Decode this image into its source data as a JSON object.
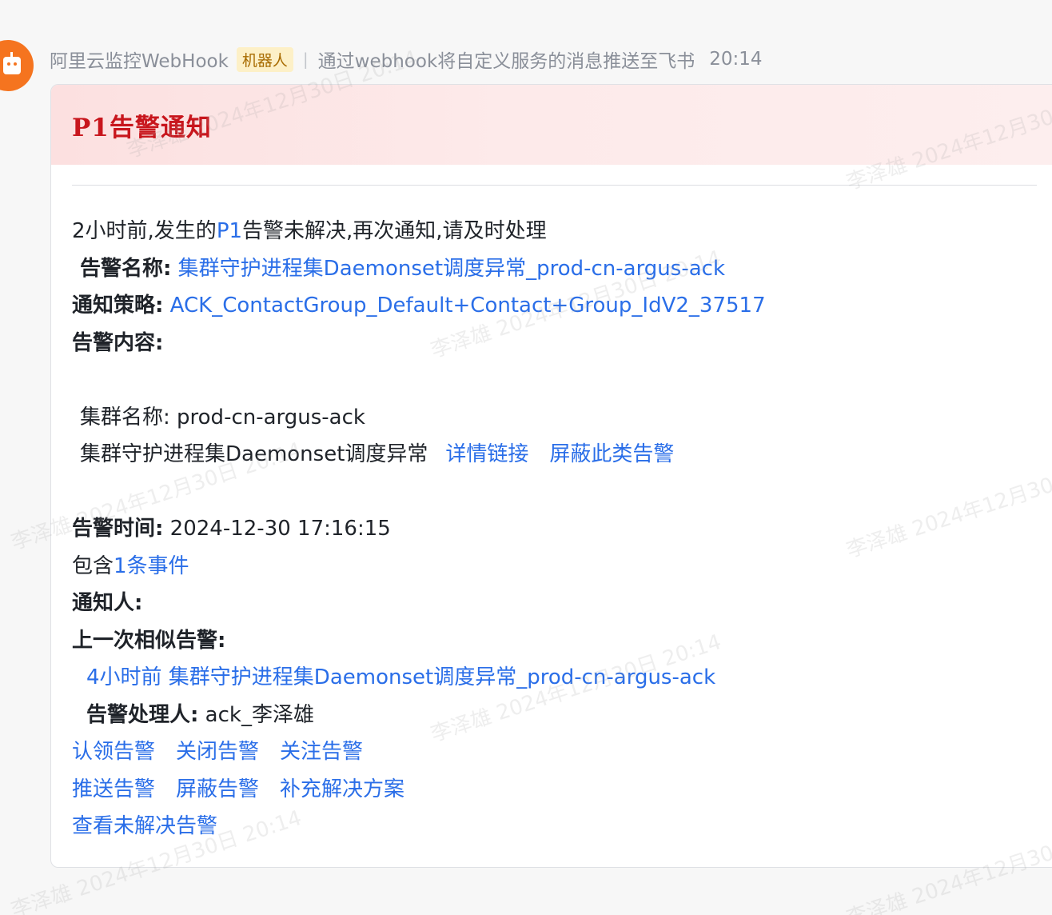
{
  "sender": {
    "name": "阿里云监控WebHook",
    "tag": "机器人",
    "separator": "|",
    "description": "通过webhook将自定义服务的消息推送至飞书",
    "time": "20:14"
  },
  "card": {
    "title": "P1告警通知",
    "intro": {
      "prefix": "2小时前,发生的",
      "level": "P1",
      "suffix": "告警未解决,再次通知,请及时处理"
    },
    "alert_name_label": "告警名称:",
    "alert_name": "集群守护进程集Daemonset调度异常_prod-cn-argus-ack",
    "policy_label": "通知策略:",
    "policy": "ACK_ContactGroup_Default+Contact+Group_IdV2_37517",
    "content_label": "告警内容:",
    "cluster_label": "集群名称:",
    "cluster_name": "prod-cn-argus-ack",
    "anomaly_text": "集群守护进程集Daemonset调度异常",
    "detail_link": "详情链接",
    "mute_similar_link": "屏蔽此类告警",
    "alert_time_label": "告警时间:",
    "alert_time": "2024-12-30 17:16:15",
    "contains_prefix": "包含",
    "contains_link": "1条事件",
    "notifier_label": "通知人:",
    "last_similar_label": "上一次相似告警:",
    "last_similar_link": "4小时前 集群守护进程集Daemonset调度异常_prod-cn-argus-ack",
    "handler_label": "告警处理人:",
    "handler": "ack_李泽雄",
    "actions_row1": [
      "认领告警",
      "关闭告警",
      "关注告警"
    ],
    "actions_row2": [
      "推送告警",
      "屏蔽告警",
      "补充解决方案"
    ],
    "actions_row3": [
      "查看未解决告警"
    ]
  },
  "watermark": "李泽雄 2024年12月30日 20:14",
  "colors": {
    "title_red": "#c8161d",
    "link_blue": "#2a6ee8",
    "avatar_orange": "#f5741f"
  }
}
